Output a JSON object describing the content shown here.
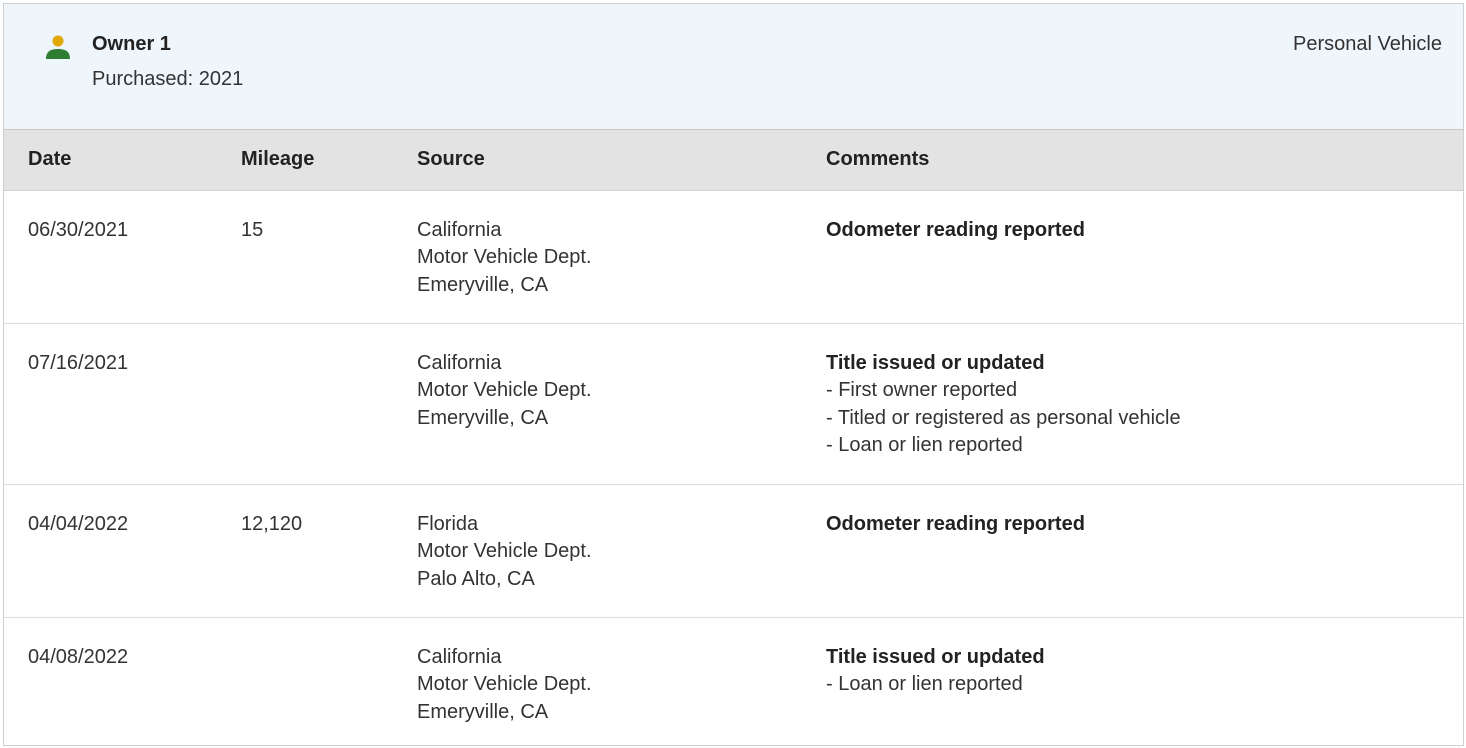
{
  "owner": {
    "title": "Owner 1",
    "purchased": "Purchased: 2021",
    "vehicle_type": "Personal Vehicle",
    "icon": "person-icon",
    "icon_color": "#2e7d32",
    "icon_head_color": "#e0a800"
  },
  "table": {
    "headers": {
      "date": "Date",
      "mileage": "Mileage",
      "source": "Source",
      "comments": "Comments"
    },
    "rows": [
      {
        "date": "06/30/2021",
        "mileage": "15",
        "source": [
          "California",
          "Motor Vehicle Dept.",
          "Emeryville, CA"
        ],
        "comment_title": "Odometer reading reported",
        "comment_items": []
      },
      {
        "date": "07/16/2021",
        "mileage": "",
        "source": [
          "California",
          "Motor Vehicle Dept.",
          "Emeryville, CA"
        ],
        "comment_title": "Title issued or updated",
        "comment_items": [
          "- First owner reported",
          "- Titled or registered as personal vehicle",
          "- Loan or lien reported"
        ]
      },
      {
        "date": "04/04/2022",
        "mileage": "12,120",
        "source": [
          "Florida",
          "Motor Vehicle Dept.",
          "Palo Alto, CA"
        ],
        "comment_title": "Odometer reading reported",
        "comment_items": []
      },
      {
        "date": "04/08/2022",
        "mileage": "",
        "source": [
          "California",
          "Motor Vehicle Dept.",
          "Emeryville, CA"
        ],
        "comment_title": "Title issued or updated",
        "comment_items": [
          "- Loan or lien reported"
        ]
      }
    ]
  }
}
